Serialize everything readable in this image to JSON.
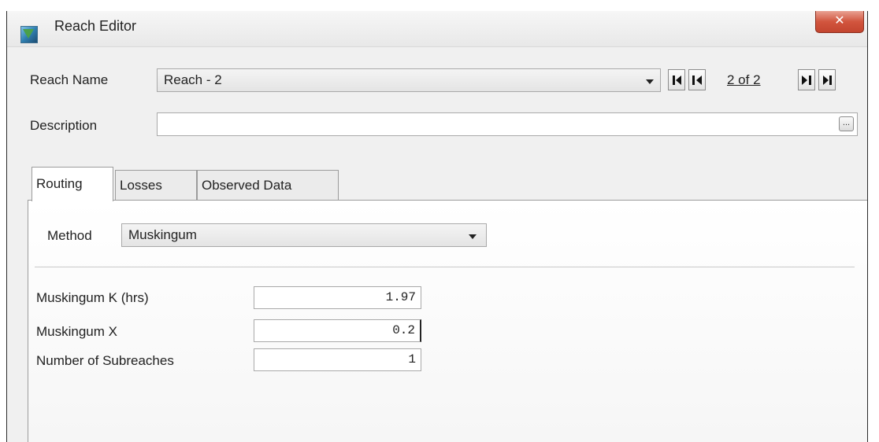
{
  "window": {
    "title": "Reach Editor",
    "close_glyph": "✕"
  },
  "form": {
    "reach_name_label": "Reach Name",
    "reach_name_value": "Reach - 2",
    "description_label": "Description",
    "description_value": "",
    "description_button": "...",
    "navigation": {
      "indicator": "2 of 2"
    }
  },
  "tabs": [
    {
      "label": "Routing",
      "active": true
    },
    {
      "label": "Losses",
      "active": false
    },
    {
      "label": "Observed Data",
      "active": false
    }
  ],
  "routing": {
    "method_label": "Method",
    "method_value": "Muskingum",
    "fields": [
      {
        "label": "Muskingum K (hrs)",
        "value": "1.97"
      },
      {
        "label": "Muskingum X",
        "value": "0.2"
      },
      {
        "label": "Number of Subreaches",
        "value": "1"
      }
    ]
  },
  "icons": {
    "app": "reach-editor-app-icon",
    "first": "first-record-icon",
    "previous": "previous-record-icon",
    "next": "next-record-icon",
    "last": "last-record-icon",
    "dropdown": "chevron-down-icon"
  },
  "colors": {
    "close_button": "#d2553e",
    "panel_background": "#ffffff",
    "client_background": "#f0f0f0"
  }
}
